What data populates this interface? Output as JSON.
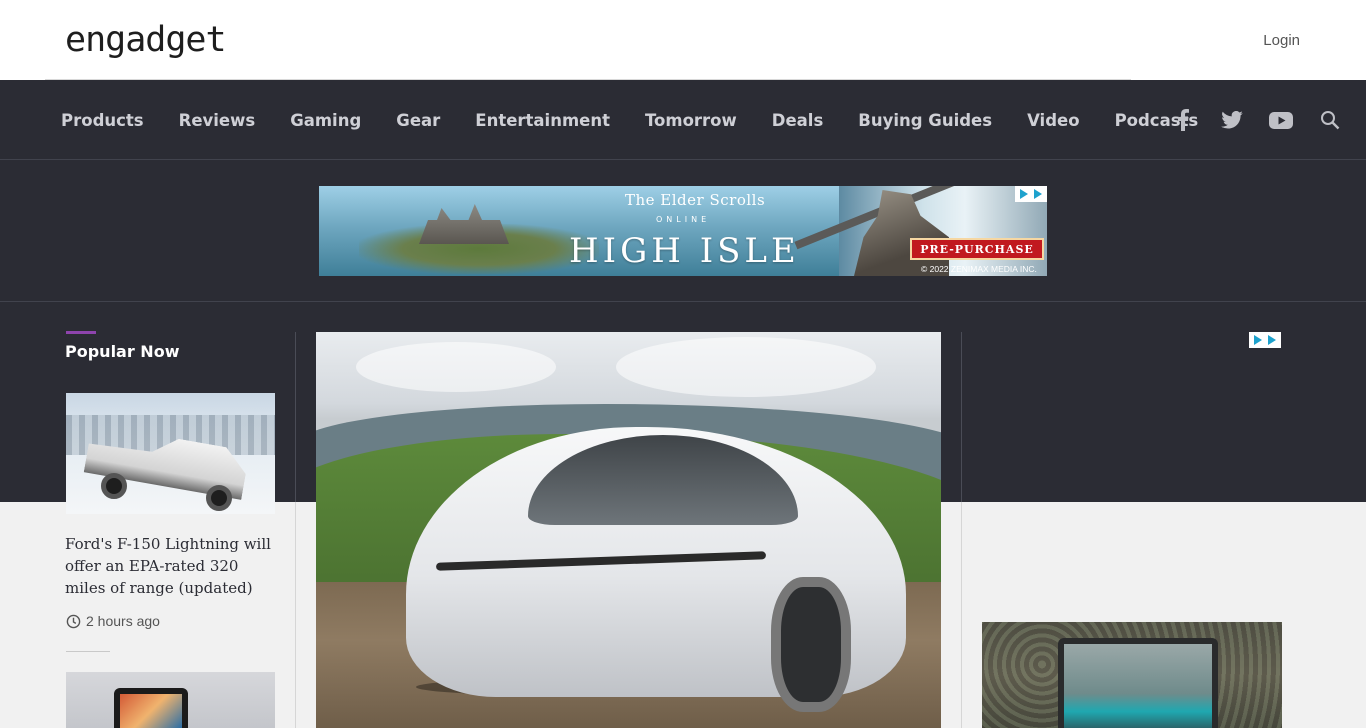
{
  "header": {
    "logo_text": "engadget",
    "login_label": "Login"
  },
  "nav": {
    "items": [
      {
        "label": "Products"
      },
      {
        "label": "Reviews"
      },
      {
        "label": "Gaming"
      },
      {
        "label": "Gear"
      },
      {
        "label": "Entertainment"
      },
      {
        "label": "Tomorrow"
      },
      {
        "label": "Deals"
      },
      {
        "label": "Buying Guides"
      },
      {
        "label": "Video"
      },
      {
        "label": "Podcasts"
      }
    ],
    "icons": [
      "facebook-icon",
      "twitter-icon",
      "youtube-icon",
      "search-icon"
    ]
  },
  "banner_ad": {
    "line1": "The Elder Scrolls",
    "line2": "ONLINE",
    "line3": "HIGH ISLE",
    "cta": "PRE-PURCHASE",
    "copyright": "© 2022 ZENIMAX MEDIA INC."
  },
  "popular": {
    "heading": "Popular Now",
    "items": [
      {
        "title": "Ford's F-150 Lightning will offer an EPA-rated 320 miles of range (updated)",
        "time": "2 hours ago"
      }
    ]
  },
  "colors": {
    "nav_bg": "#2b2c34",
    "accent": "#8e44ad",
    "page_bg": "#f1f1f1"
  }
}
